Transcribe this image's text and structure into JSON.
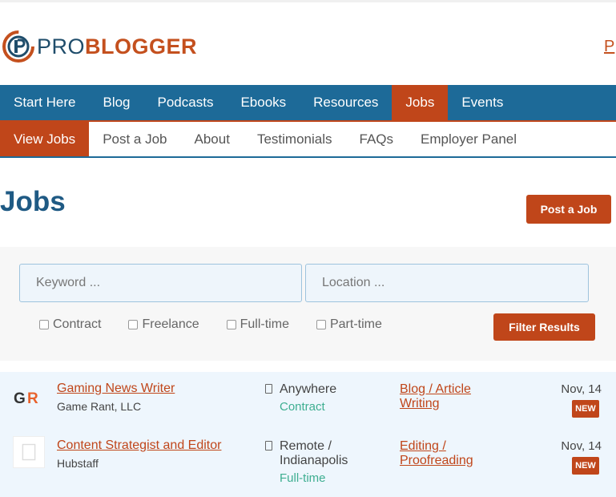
{
  "header": {
    "logo": {
      "pro": "PRO",
      "blog": "BLOGGER"
    },
    "partial_link": "P"
  },
  "main_nav": {
    "items": [
      {
        "label": "Start Here"
      },
      {
        "label": "Blog"
      },
      {
        "label": "Podcasts"
      },
      {
        "label": "Ebooks"
      },
      {
        "label": "Resources"
      },
      {
        "label": "Jobs",
        "active": true
      },
      {
        "label": "Events"
      }
    ]
  },
  "sub_nav": {
    "items": [
      {
        "label": "View Jobs",
        "active": true
      },
      {
        "label": "Post a Job"
      },
      {
        "label": "About"
      },
      {
        "label": "Testimonials"
      },
      {
        "label": "FAQs"
      },
      {
        "label": "Employer Panel"
      }
    ]
  },
  "page": {
    "title": "Jobs",
    "post_job_label": "Post a Job"
  },
  "filters": {
    "keyword_placeholder": "Keyword ...",
    "location_placeholder": "Location ...",
    "types": [
      "Contract",
      "Freelance",
      "Full-time",
      "Part-time"
    ],
    "submit_label": "Filter Results"
  },
  "jobs": [
    {
      "logo_icon": "game-rant-logo",
      "title": "Gaming News Writer",
      "company": "Game Rant, LLC",
      "location": "Anywhere",
      "type": "Contract",
      "category": "Blog / Article Writing",
      "date": "Nov, 14",
      "badge": "NEW"
    },
    {
      "logo_icon": "hubstaff-logo",
      "title": "Content Strategist and Editor",
      "company": "Hubstaff",
      "location": "Remote / Indianapolis",
      "type": "Full-time",
      "category": "Editing / Proofreading",
      "date": "Nov, 14",
      "badge": "NEW"
    }
  ],
  "colors": {
    "brand_orange": "#c0461a",
    "nav_blue": "#1d6a98",
    "title_blue": "#1f5a84",
    "type_green": "#3eae91",
    "row_bg": "#eef6fd"
  }
}
